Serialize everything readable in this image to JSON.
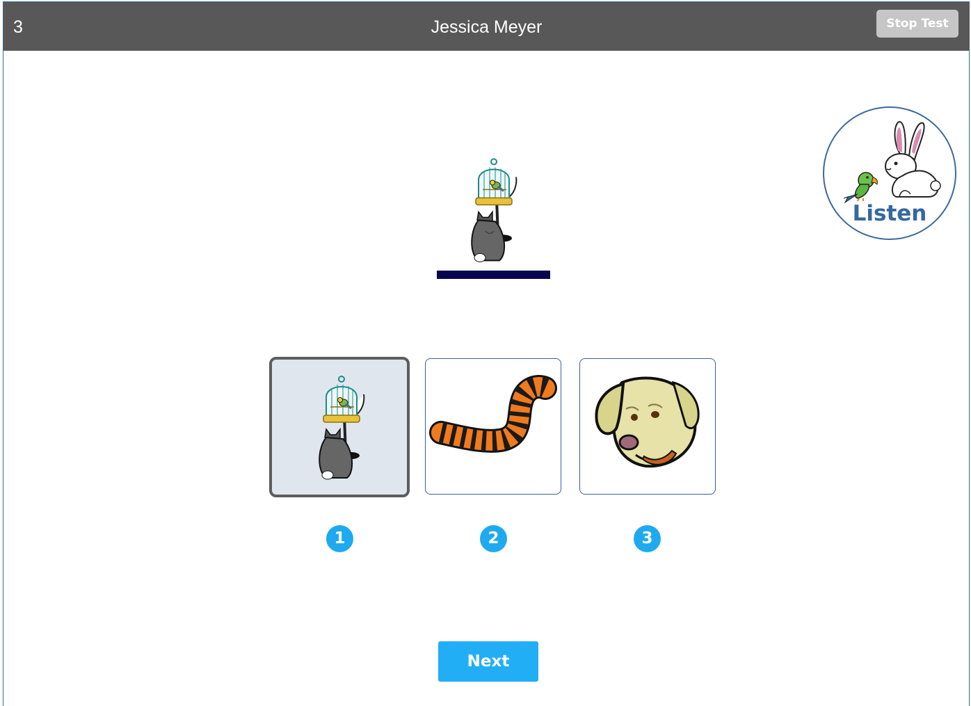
{
  "header": {
    "question_number": "3",
    "student_name": "Jessica Meyer",
    "stop_label": "Stop Test"
  },
  "listen": {
    "label": "Listen",
    "icon": "parrot-rabbit-icon"
  },
  "prompt": {
    "icon": "cat-watching-birdcage-icon"
  },
  "choices": [
    {
      "number": "1",
      "icon": "cat-watching-birdcage-icon",
      "selected": true
    },
    {
      "number": "2",
      "icon": "striped-tail-icon",
      "selected": false
    },
    {
      "number": "3",
      "icon": "dog-head-icon",
      "selected": false
    }
  ],
  "footer": {
    "next_label": "Next"
  },
  "colors": {
    "header_bg": "#585858",
    "accent": "#22aef5",
    "listen_text": "#3568a0",
    "answer_line": "#06064f"
  }
}
